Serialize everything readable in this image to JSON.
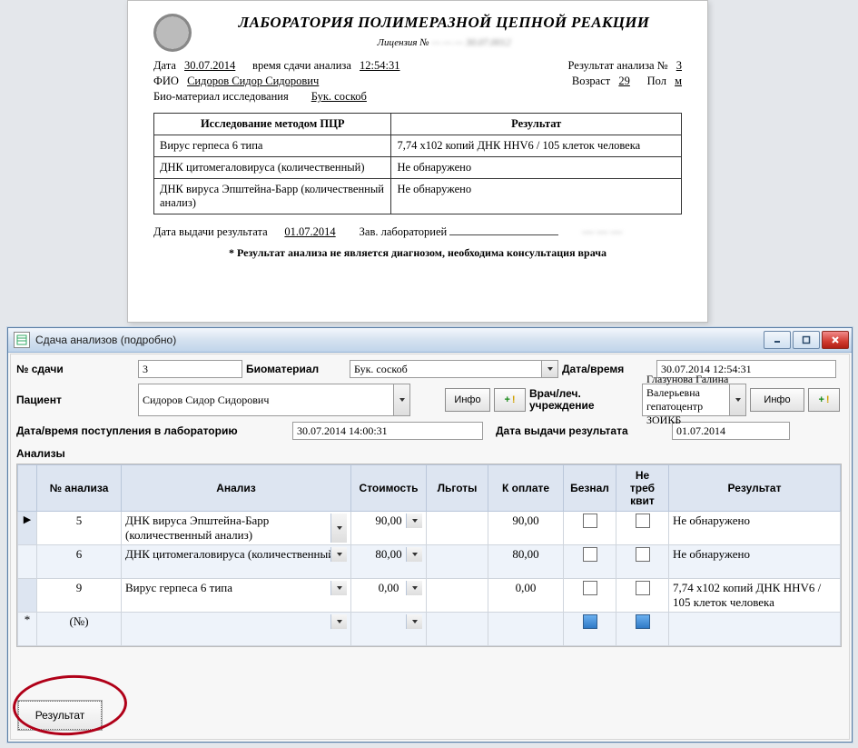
{
  "report": {
    "title": "ЛАБОРАТОРИЯ ПОЛИМЕРАЗНОЙ ЦЕПНОЙ РЕАКЦИИ",
    "license_label": "Лицензия №",
    "license_blur": "— — — 30.07.0012",
    "date_label": "Дата",
    "date": "30.07.2014",
    "time_label": "время сдачи анализа",
    "time": "12:54:31",
    "result_no_label": "Результат анализа №",
    "result_no": "3",
    "fio_label": "ФИО",
    "fio": "Сидоров Сидор Сидорович",
    "age_label": "Возраст",
    "age": "29",
    "sex_label": "Пол",
    "sex": "м",
    "biomat_label": "Био-материал исследования",
    "biomat": "Бук. соскоб",
    "col_test": "Исследование методом ПЦР",
    "col_result": "Результат",
    "rows": [
      {
        "test": "Вирус герпеса 6 типа",
        "result": "7,74 x102  копий ДНК HHV6 / 105 клеток человека"
      },
      {
        "test": "ДНК цитомегаловируса (количественный)",
        "result": "Не обнаружено"
      },
      {
        "test": "ДНК вируса Эпштейна-Барр (количественный анализ)",
        "result": "Не обнаружено"
      }
    ],
    "issue_date_label": "Дата выдачи результата",
    "issue_date": "01.07.2014",
    "lab_head_label": "Зав. лабораторией",
    "disclaimer": "* Результат анализа не является диагнозом, необходима консультация врача"
  },
  "win": {
    "title": "Сдача анализов (подробно)",
    "labels": {
      "no": "№ сдачи",
      "biomaterial": "Биоматериал",
      "datetime": "Дата/время",
      "patient": "Пациент",
      "info": "Инфо",
      "doctor": "Врач/леч. учреждение",
      "arrival": "Дата/время поступления в лабораторию",
      "issue": "Дата выдачи результата",
      "analyses": "Анализы",
      "result_btn": "Результат"
    },
    "values": {
      "no": "3",
      "biomaterial": "Бук. соскоб",
      "datetime": "30.07.2014 12:54:31",
      "patient": "Сидоров Сидор Сидорович",
      "doctor": "Глазунова Галина Валерьевна гепатоцентр ЗОИКБ",
      "arrival": "30.07.2014 14:00:31",
      "issue": "01.07.2014"
    },
    "grid": {
      "headers": {
        "num": "№ анализа",
        "analysis": "Анализ",
        "cost": "Стоимость",
        "discount": "Льготы",
        "topay": "К оплате",
        "cashless": "Безнал",
        "noreceipt": "Не треб квит",
        "result": "Результат"
      },
      "rows": [
        {
          "num": "5",
          "analysis": "ДНК вируса Эпштейна-Барр (количественный анализ)",
          "cost": "90,00",
          "discount": "",
          "topay": "90,00",
          "cashless": false,
          "noreceipt": false,
          "result": "Не обнаружено"
        },
        {
          "num": "6",
          "analysis": "ДНК цитомегаловируса (количественный)",
          "cost": "80,00",
          "discount": "",
          "topay": "80,00",
          "cashless": false,
          "noreceipt": false,
          "result": "Не обнаружено"
        },
        {
          "num": "9",
          "analysis": "Вирус герпеса 6 типа",
          "cost": "0,00",
          "discount": "",
          "topay": "0,00",
          "cashless": false,
          "noreceipt": false,
          "result": "7,74 x102  копий ДНК HHV6 / 105 клеток человека"
        }
      ],
      "newrow_placeholder": "(№)"
    }
  }
}
